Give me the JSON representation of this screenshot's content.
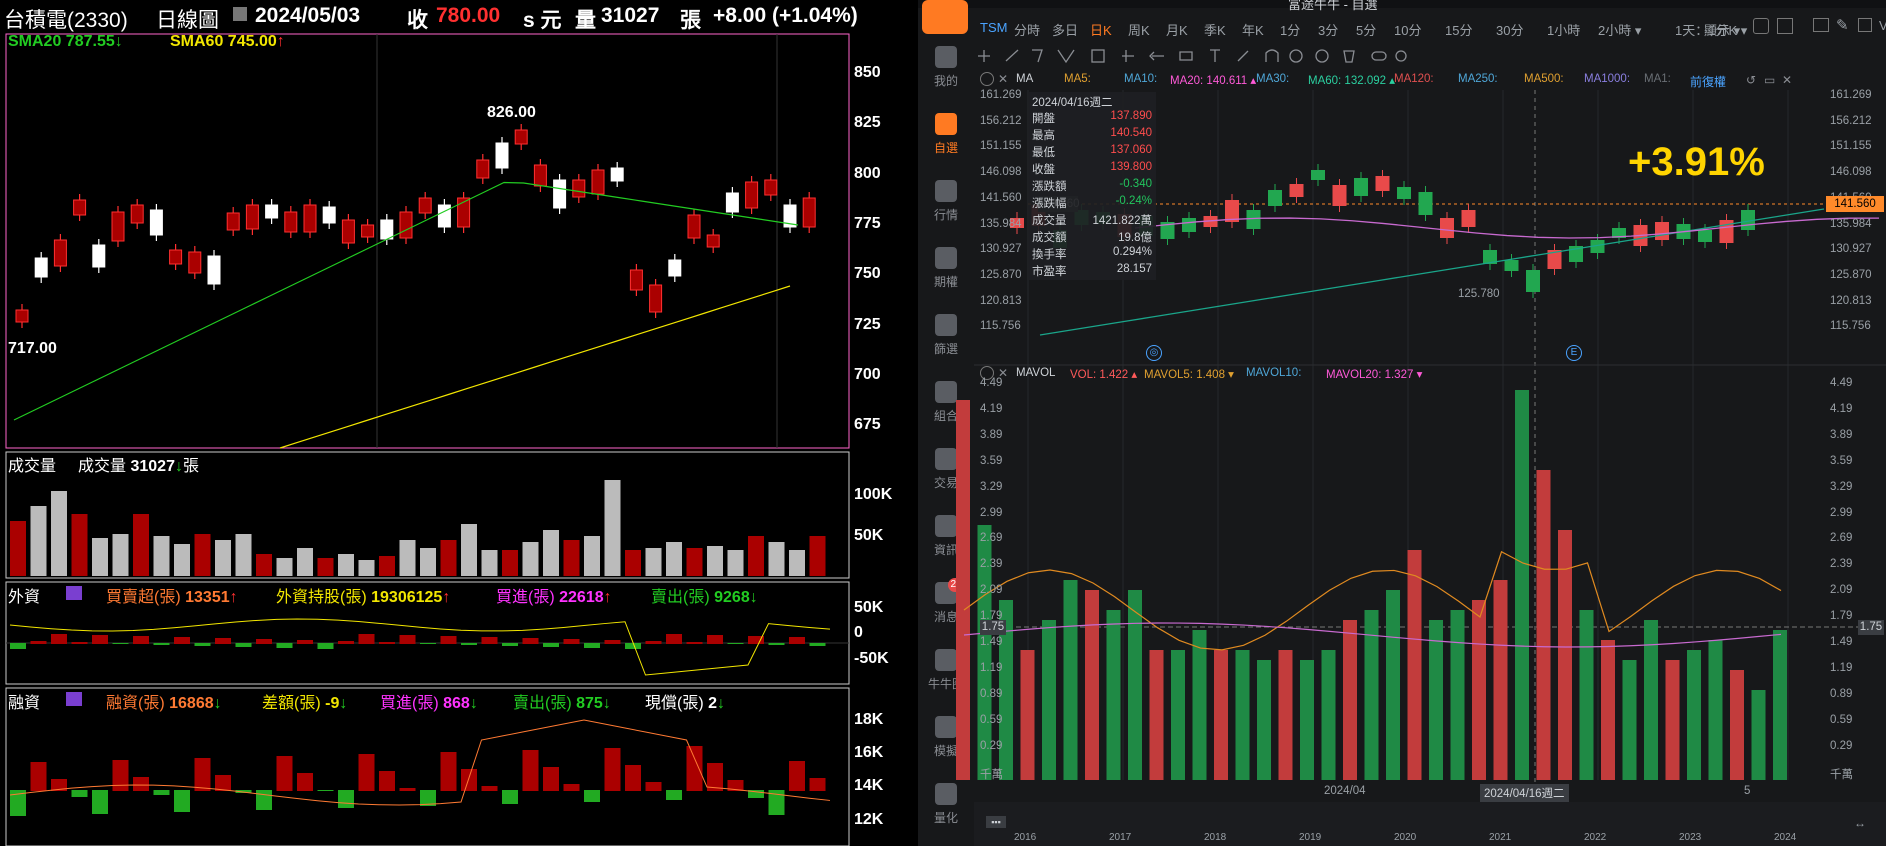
{
  "left": {
    "header": {
      "name": "台積電(2330)",
      "period": "日線圖",
      "date": "2024/05/03",
      "close_label": "收",
      "close": "780.00",
      "suffix": "s 元",
      "volume_label": "量",
      "volume": "31027",
      "unit": "張",
      "change": "+8.00 (+1.04%)"
    },
    "legend": {
      "sma20": "SMA20 787.55",
      "sma60": "SMA60 745.00"
    },
    "price_axis": [
      "850",
      "825",
      "800",
      "775",
      "750",
      "725",
      "700",
      "675"
    ],
    "annotations": {
      "high": "826.00",
      "low": "717.00"
    },
    "volume_panel": {
      "title": "成交量",
      "label": "成交量",
      "value": "31027",
      "unit": "張",
      "axis": [
        "100K",
        "50K"
      ]
    },
    "foreign_panel": {
      "title": "外資",
      "items": [
        {
          "label": "買賣超(張)",
          "value": "13351"
        },
        {
          "label": "外資持股(張)",
          "value": "19306125"
        },
        {
          "label": "買進(張)",
          "value": "22618"
        },
        {
          "label": "賣出(張)",
          "value": "9268"
        }
      ],
      "axis": [
        "50K",
        "0",
        "-50K"
      ]
    },
    "margin_panel": {
      "title": "融資",
      "items": [
        {
          "label": "融資(張)",
          "value": "16868"
        },
        {
          "label": "差額(張)",
          "value": "-9"
        },
        {
          "label": "買進(張)",
          "value": "868"
        },
        {
          "label": "賣出(張)",
          "value": "875"
        },
        {
          "label": "現償(張)",
          "value": "2"
        }
      ],
      "axis": [
        "18K",
        "16K",
        "14K",
        "12K"
      ]
    },
    "colors": {
      "up": "#c00000",
      "down": "#ffffff",
      "sma20": "#22cc22",
      "sma60": "#f2e600",
      "frame": "#ff66cc"
    }
  },
  "right": {
    "window_title": "富途牛牛 - 自選",
    "sidebar": [
      {
        "icon": "user-icon",
        "label": "我的"
      },
      {
        "icon": "watchlist-icon",
        "label": "自選"
      },
      {
        "icon": "market-icon",
        "label": "行情"
      },
      {
        "icon": "futures-icon",
        "label": "期權"
      },
      {
        "icon": "filter-icon",
        "label": "篩選"
      },
      {
        "icon": "portfolio-icon",
        "label": "組合"
      },
      {
        "icon": "trade-icon",
        "label": "交易"
      },
      {
        "icon": "news-icon",
        "label": "資訊"
      },
      {
        "icon": "message-icon",
        "label": "消息",
        "badge": "20"
      },
      {
        "icon": "community-icon",
        "label": "牛牛圈"
      },
      {
        "icon": "simulate-icon",
        "label": "模擬"
      },
      {
        "icon": "quant-icon",
        "label": "量化"
      }
    ],
    "symbol": "TSM",
    "period_tabs": [
      "分時",
      "多日",
      "日K",
      "周K",
      "月K",
      "季K",
      "年K",
      "1分",
      "3分",
      "5分",
      "10分",
      "15分",
      "30分",
      "1小時",
      "2小時 ▾",
      "1天：1分K ▾"
    ],
    "active_tab": "日K",
    "display_label": "顯示 ▾",
    "ma_row": [
      {
        "label": "MA",
        "color": "#cfd3d8"
      },
      {
        "label": "MA5:",
        "color": "#e0a030"
      },
      {
        "label": "MA10:",
        "color": "#4fa7d8"
      },
      {
        "label": "MA20: 140.611 ▴",
        "color": "#ff5ad8"
      },
      {
        "label": "MA30:",
        "color": "#4fa7d8"
      },
      {
        "label": "MA60: 132.092 ▴",
        "color": "#2bd0a0"
      },
      {
        "label": "MA120:",
        "color": "#e05050"
      },
      {
        "label": "MA250:",
        "color": "#4fa7d8"
      },
      {
        "label": "MA500:",
        "color": "#e0a030"
      },
      {
        "label": "MA1000:",
        "color": "#8a7fe0"
      },
      {
        "label": "MA1:",
        "color": "#6a6f75"
      }
    ],
    "adjust_label": "前復權",
    "price_axis": [
      "161.269",
      "156.212",
      "151.155",
      "146.098",
      "141.560",
      "135.984",
      "130.927",
      "125.870",
      "120.813",
      "115.756"
    ],
    "current_price": "141.560",
    "info_box": {
      "date": "2024/04/16週二",
      "rows": [
        {
          "label": "開盤",
          "value": "137.890",
          "color": "#ff4d4d"
        },
        {
          "label": "最高",
          "value": "140.540",
          "color": "#ff4d4d"
        },
        {
          "label": "最低",
          "value": "137.060",
          "color": "#ff4d4d"
        },
        {
          "label": "收盤",
          "value": "139.800",
          "color": "#ff4d4d"
        },
        {
          "label": "漲跌額",
          "value": "-0.340",
          "color": "#22c55e"
        },
        {
          "label": "漲跌幅",
          "value": "-0.24%",
          "color": "#22c55e"
        },
        {
          "label": "成交量",
          "value": "1421.822萬",
          "color": "#cfd3d8"
        },
        {
          "label": "成交額",
          "value": "19.8億",
          "color": "#cfd3d8"
        },
        {
          "label": "換手率",
          "value": "0.294%",
          "color": "#cfd3d8"
        },
        {
          "label": "市盈率",
          "value": "28.157",
          "color": "#cfd3d8"
        }
      ]
    },
    "big_label": "+3.91%",
    "low_label": "125.780",
    "vol_row": [
      {
        "label": "MAVOL",
        "color": "#cfd3d8"
      },
      {
        "label": "VOL: 1.422 ▴",
        "color": "#ff5a5a"
      },
      {
        "label": "MAVOL5: 1.408 ▾",
        "color": "#e0a030"
      },
      {
        "label": "MAVOL10:",
        "color": "#4fa7d8"
      },
      {
        "label": "MAVOL20: 1.327 ▾",
        "color": "#ff5ad8"
      }
    ],
    "vol_axis": [
      "4.49",
      "4.19",
      "3.89",
      "3.59",
      "3.29",
      "2.99",
      "2.69",
      "2.39",
      "2.09",
      "1.79",
      "1.49",
      "1.19",
      "0.89",
      "0.59",
      "0.29",
      "千萬"
    ],
    "vol_crosshair": "1.75",
    "date_axis": [
      "2024/04",
      "2024/04/16週二",
      "5"
    ],
    "year_axis": [
      "2016",
      "2017",
      "2018",
      "2019",
      "2020",
      "2021",
      "2022",
      "2023",
      "2024"
    ],
    "colors": {
      "up": "#e84a4a",
      "down": "#22a750",
      "ma20": "#c86ad0",
      "ma60": "#1aa58a",
      "mavol5": "#e08a20",
      "mavol20": "#c86ad0",
      "highlight": "#ffd400"
    }
  }
}
